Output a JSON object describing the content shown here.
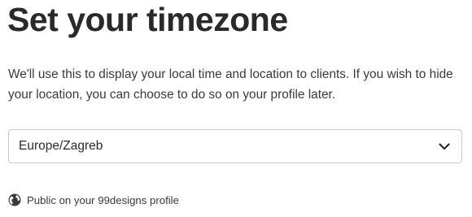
{
  "page": {
    "title": "Set your timezone",
    "description": "We'll use this to display your local time and location to clients. If you wish to hide your location, you can choose to do so on your profile later."
  },
  "timezone_select": {
    "value": "Europe/Zagreb",
    "chevron_icon": "chevron-down-icon"
  },
  "privacy": {
    "icon": "globe-icon",
    "text": "Public on your 99designs profile"
  }
}
